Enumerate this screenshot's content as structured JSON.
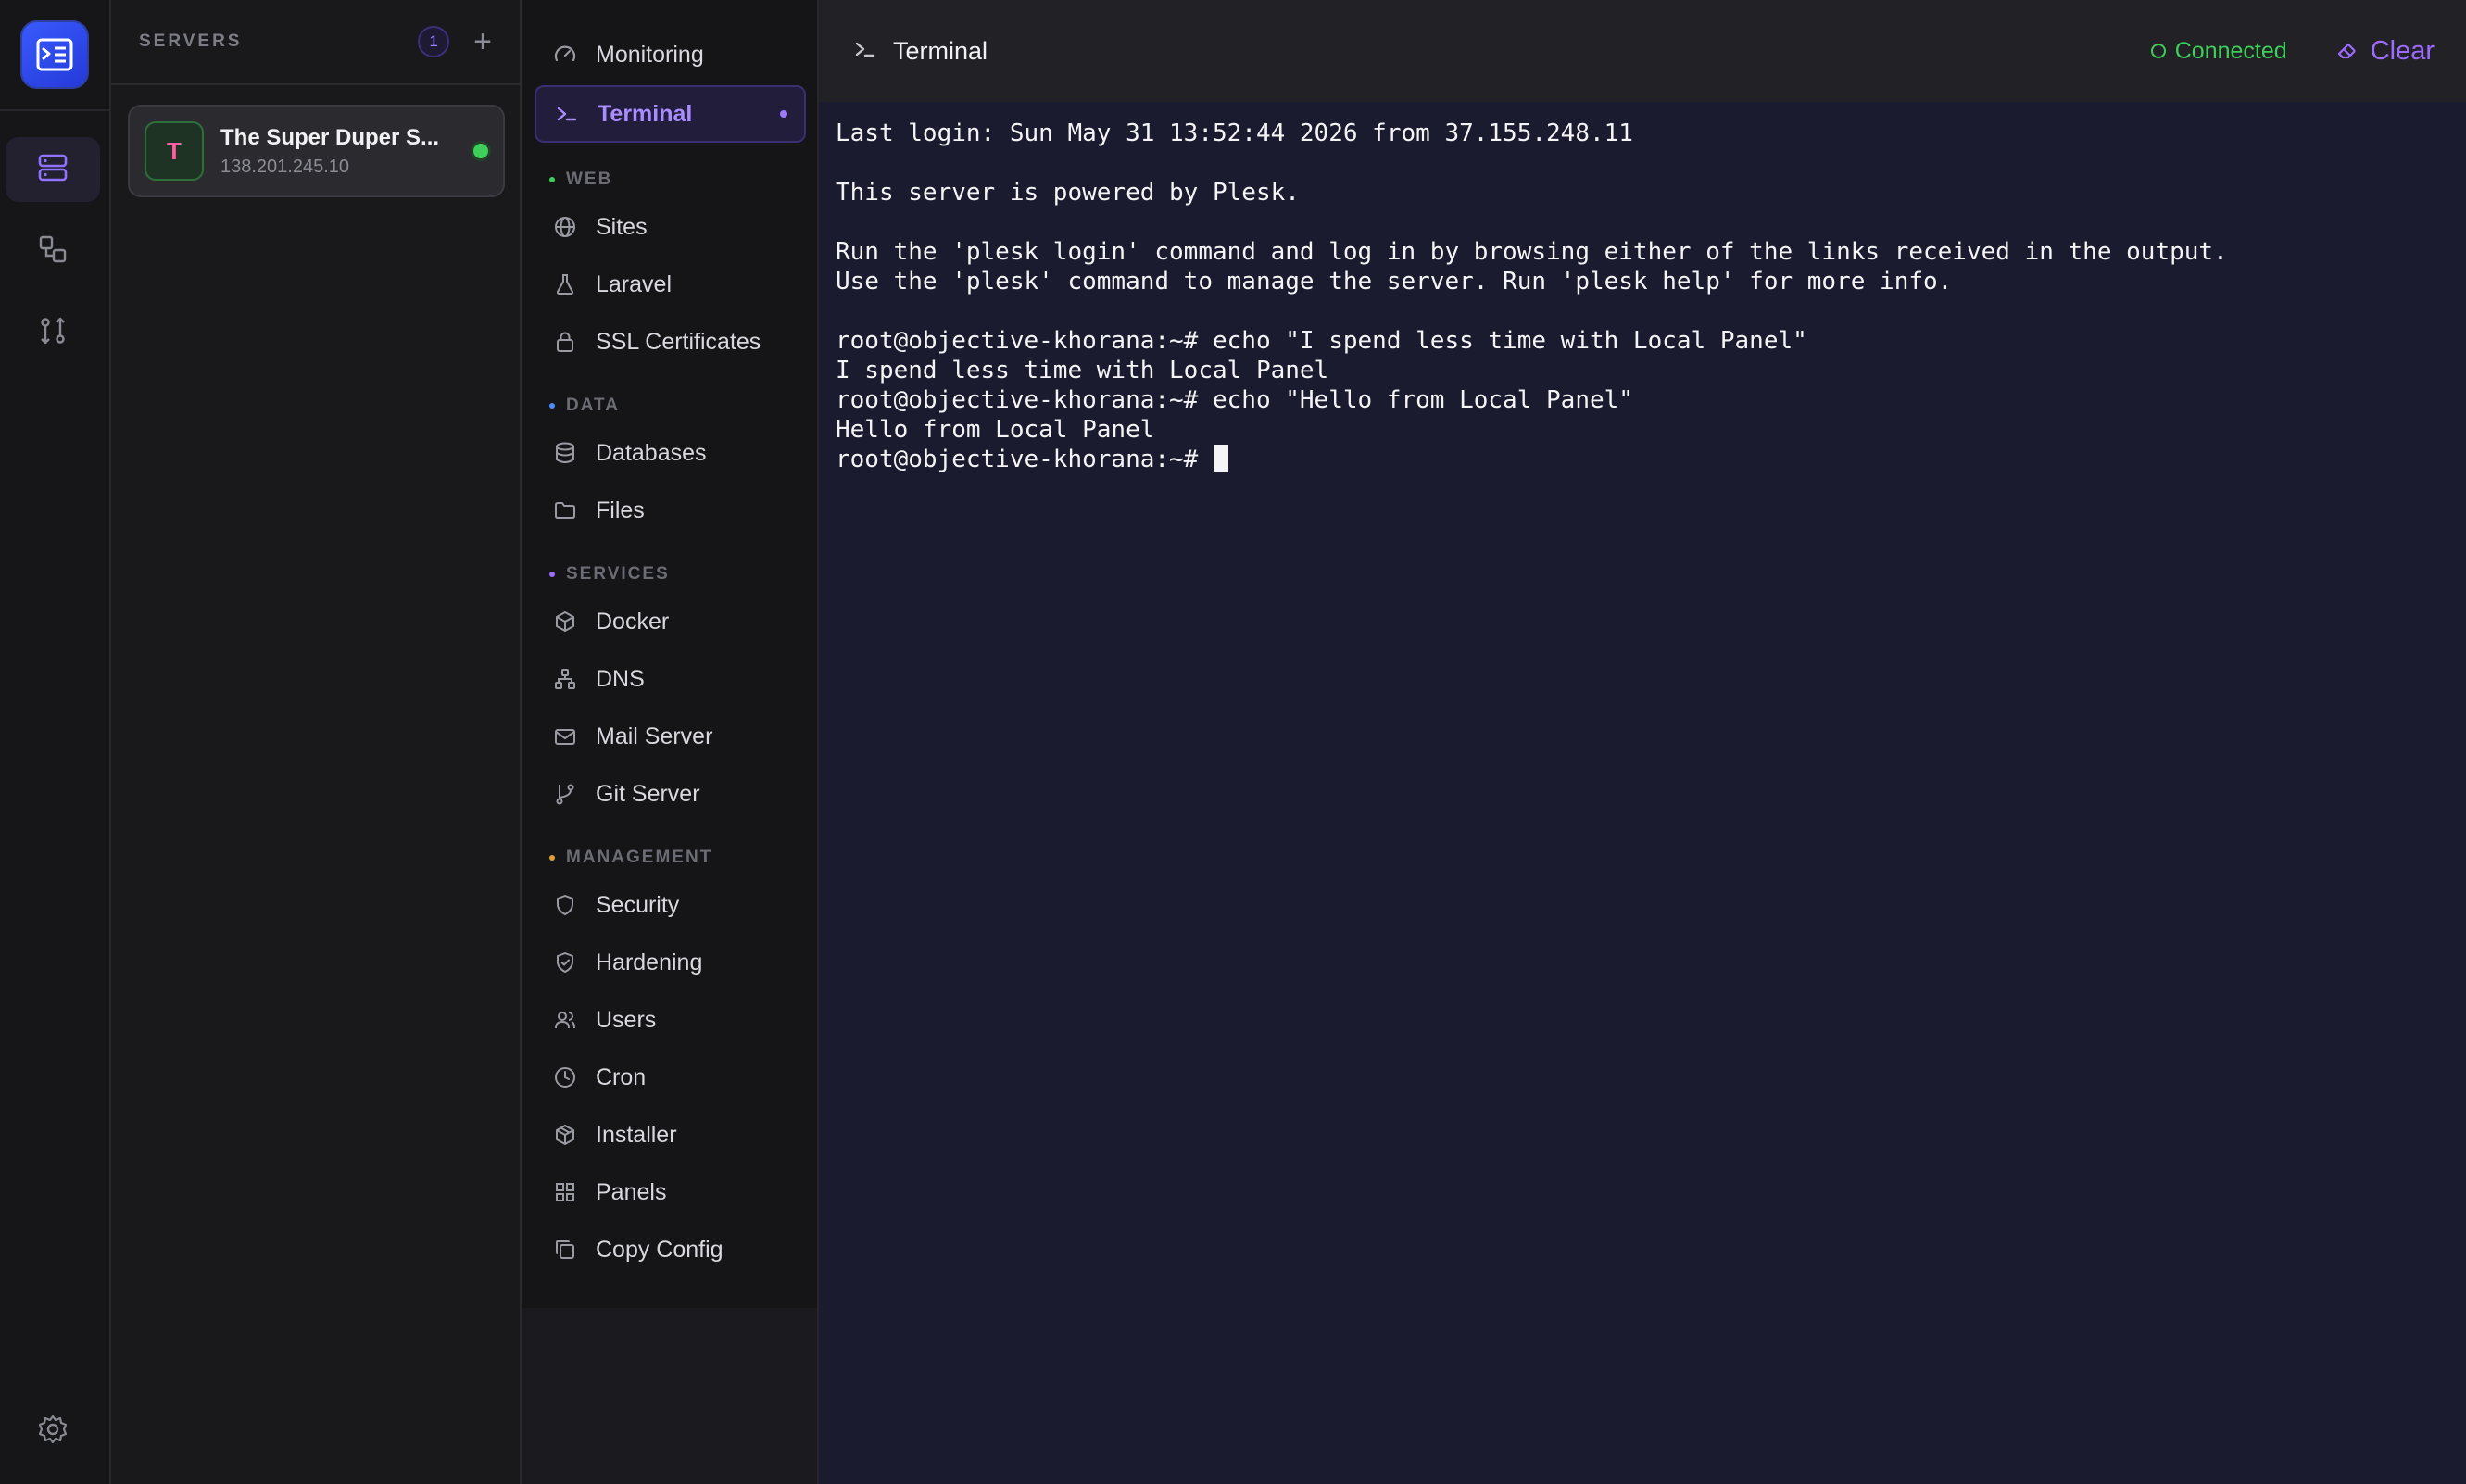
{
  "rail": {
    "logo_icon": "terminal-server-logo",
    "items": [
      {
        "icon": "servers-icon",
        "active": true
      },
      {
        "icon": "shapes-icon",
        "active": false
      },
      {
        "icon": "git-compare-icon",
        "active": false
      }
    ],
    "settings_icon": "gear-icon"
  },
  "servers": {
    "title": "SERVERS",
    "count": "1",
    "add_label": "+",
    "card": {
      "avatar_letter": "T",
      "name": "The Super Duper S...",
      "ip": "138.201.245.10",
      "status": "online"
    }
  },
  "nav": {
    "top_items": [
      {
        "label": "Monitoring",
        "icon": "gauge-icon"
      },
      {
        "label": "Terminal",
        "icon": "terminal-icon",
        "active": true
      }
    ],
    "sections": [
      {
        "label": "WEB",
        "color": "#3ecf5b",
        "items": [
          {
            "label": "Sites",
            "icon": "globe-icon"
          },
          {
            "label": "Laravel",
            "icon": "flask-icon"
          },
          {
            "label": "SSL Certificates",
            "icon": "lock-icon"
          }
        ]
      },
      {
        "label": "DATA",
        "color": "#4a8cff",
        "items": [
          {
            "label": "Databases",
            "icon": "database-icon"
          },
          {
            "label": "Files",
            "icon": "folder-icon"
          }
        ]
      },
      {
        "label": "SERVICES",
        "color": "#9d6bff",
        "items": [
          {
            "label": "Docker",
            "icon": "box-icon"
          },
          {
            "label": "DNS",
            "icon": "network-icon"
          },
          {
            "label": "Mail Server",
            "icon": "mail-icon"
          },
          {
            "label": "Git Server",
            "icon": "git-branch-icon"
          }
        ]
      },
      {
        "label": "MANAGEMENT",
        "color": "#e0a030",
        "items": [
          {
            "label": "Security",
            "icon": "shield-icon"
          },
          {
            "label": "Hardening",
            "icon": "shield-check-icon"
          },
          {
            "label": "Users",
            "icon": "users-icon"
          },
          {
            "label": "Cron",
            "icon": "clock-icon"
          },
          {
            "label": "Installer",
            "icon": "package-icon"
          },
          {
            "label": "Panels",
            "icon": "grid-icon"
          },
          {
            "label": "Copy Config",
            "icon": "copy-icon"
          }
        ]
      }
    ]
  },
  "terminal": {
    "title": "Terminal",
    "status": "Connected",
    "clear_label": "Clear",
    "lines": [
      "Last login: Sun May 31 13:52:44 2026 from 37.155.248.11",
      "",
      "This server is powered by Plesk.",
      "",
      "Run the 'plesk login' command and log in by browsing either of the links received in the output.",
      "Use the 'plesk' command to manage the server. Run 'plesk help' for more info.",
      "",
      "root@objective-khorana:~# echo \"I spend less time with Local Panel\"",
      "I spend less time with Local Panel",
      "root@objective-khorana:~# echo \"Hello from Local Panel\"",
      "Hello from Local Panel"
    ],
    "prompt": "root@objective-khorana:~# "
  },
  "colors": {
    "accent": "#9d6bff",
    "connected": "#3ecf5b",
    "terminal_bg": "#1a1b2e"
  }
}
